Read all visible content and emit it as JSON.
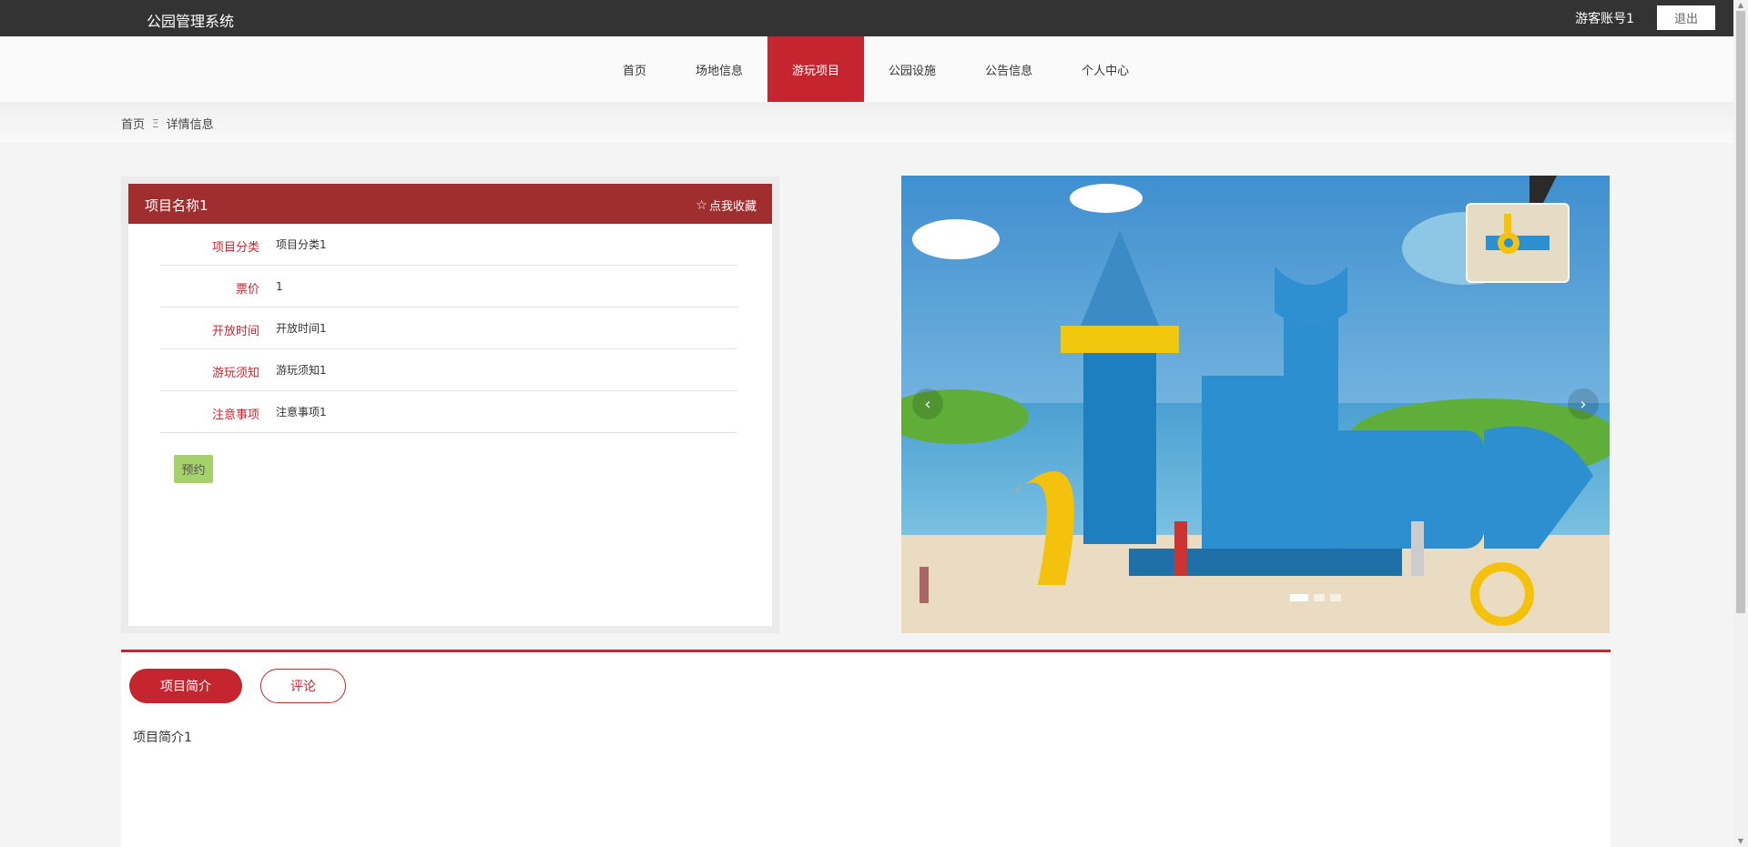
{
  "topbar": {
    "app_title": "公园管理系统",
    "account": "游客账号1",
    "logout_label": "退出"
  },
  "nav": {
    "items": [
      {
        "label": "首页",
        "active": false
      },
      {
        "label": "场地信息",
        "active": false
      },
      {
        "label": "游玩项目",
        "active": true
      },
      {
        "label": "公园设施",
        "active": false
      },
      {
        "label": "公告信息",
        "active": false
      },
      {
        "label": "个人中心",
        "active": false
      }
    ]
  },
  "breadcrumb": {
    "home": "首页",
    "separator": "Ξ",
    "current": "详情信息"
  },
  "detail": {
    "name": "项目名称1",
    "favorite_label": "点我收藏",
    "favorite_icon": "star-outline-icon",
    "rows": [
      {
        "label": "项目分类",
        "value": "项目分类1"
      },
      {
        "label": "票价",
        "value": "1"
      },
      {
        "label": "开放时间",
        "value": "开放时间1"
      },
      {
        "label": "游玩须知",
        "value": "游玩须知1"
      },
      {
        "label": "注意事项",
        "value": "注意事项1"
      }
    ],
    "book_label": "预约"
  },
  "carousel": {
    "prev_icon": "chevron-left-icon",
    "next_icon": "chevron-right-icon",
    "slide_count": 3,
    "active_slide": 1
  },
  "tabs": {
    "intro_label": "项目简介",
    "comment_label": "评论",
    "intro_text": "项目简介1"
  },
  "colors": {
    "brand_red": "#c4252f",
    "header_red": "#a12e2f",
    "book_green": "#a5d16b",
    "topbar": "#333333"
  }
}
